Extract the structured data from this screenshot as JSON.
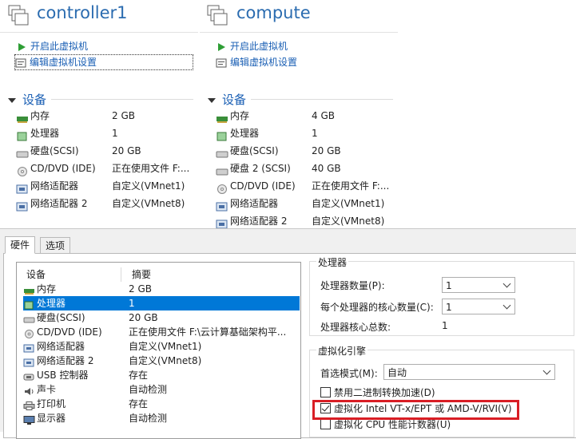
{
  "vms": [
    {
      "name": "controller1",
      "actions": [
        {
          "label": "开启此虚拟机",
          "icon": "play-icon"
        },
        {
          "label": "编辑虚拟机设置",
          "icon": "settings-icon"
        }
      ],
      "section_title": "设备",
      "devices": [
        {
          "name": "内存",
          "value": "2 GB",
          "icon": "memory-icon"
        },
        {
          "name": "处理器",
          "value": "1",
          "icon": "cpu-icon"
        },
        {
          "name": "硬盘(SCSI)",
          "value": "20 GB",
          "icon": "harddisk-icon"
        },
        {
          "name": "CD/DVD (IDE)",
          "value": "正在使用文件 F:...",
          "icon": "cd-dvd-icon"
        },
        {
          "name": "网络适配器",
          "value": "自定义(VMnet1)",
          "icon": "network-icon"
        },
        {
          "name": "网络适配器 2",
          "value": "自定义(VMnet8)",
          "icon": "network-icon"
        }
      ]
    },
    {
      "name": "compute",
      "actions": [
        {
          "label": "开启此虚拟机",
          "icon": "play-icon"
        },
        {
          "label": "编辑虚拟机设置",
          "icon": "settings-icon"
        }
      ],
      "section_title": "设备",
      "devices": [
        {
          "name": "内存",
          "value": "4 GB",
          "icon": "memory-icon"
        },
        {
          "name": "处理器",
          "value": "1",
          "icon": "cpu-icon"
        },
        {
          "name": "硬盘(SCSI)",
          "value": "20 GB",
          "icon": "harddisk-icon"
        },
        {
          "name": "硬盘 2 (SCSI)",
          "value": "40 GB",
          "icon": "harddisk-icon"
        },
        {
          "name": "CD/DVD (IDE)",
          "value": "正在使用文件 F:...",
          "icon": "cd-dvd-icon"
        },
        {
          "name": "网络适配器",
          "value": "自定义(VMnet1)",
          "icon": "network-icon"
        },
        {
          "name": "网络适配器 2",
          "value": "自定义(VMnet8)",
          "icon": "network-icon"
        }
      ]
    }
  ],
  "dialog": {
    "tabs": [
      {
        "label": "硬件",
        "active": true
      },
      {
        "label": "选项",
        "active": false
      }
    ],
    "hardware_list": {
      "columns": [
        "设备",
        "摘要"
      ],
      "rows": [
        {
          "device": "内存",
          "summary": "2 GB",
          "icon": "memory-icon",
          "selected": false
        },
        {
          "device": "处理器",
          "summary": "1",
          "icon": "cpu-icon",
          "selected": true
        },
        {
          "device": "硬盘(SCSI)",
          "summary": "20 GB",
          "icon": "harddisk-icon",
          "selected": false
        },
        {
          "device": "CD/DVD (IDE)",
          "summary": "正在使用文件 F:\\云计算基础架构平...",
          "icon": "cd-dvd-icon",
          "selected": false
        },
        {
          "device": "网络适配器",
          "summary": "自定义(VMnet1)",
          "icon": "network-icon",
          "selected": false
        },
        {
          "device": "网络适配器 2",
          "summary": "自定义(VMnet8)",
          "icon": "network-icon",
          "selected": false
        },
        {
          "device": "USB 控制器",
          "summary": "存在",
          "icon": "usb-icon",
          "selected": false
        },
        {
          "device": "声卡",
          "summary": "自动检测",
          "icon": "sound-icon",
          "selected": false
        },
        {
          "device": "打印机",
          "summary": "存在",
          "icon": "printer-icon",
          "selected": false
        },
        {
          "device": "显示器",
          "summary": "自动检测",
          "icon": "display-icon",
          "selected": false
        }
      ]
    },
    "processor_group": {
      "title": "处理器",
      "count_label": "处理器数量(P):",
      "count_value": "1",
      "cores_label": "每个处理器的核心数量(C):",
      "cores_value": "1",
      "total_label": "处理器核心总数:",
      "total_value": "1"
    },
    "virt_group": {
      "title": "虚拟化引擎",
      "mode_label": "首选模式(M):",
      "mode_value": "自动",
      "options": [
        {
          "label": "禁用二进制转换加速(D)",
          "checked": false
        },
        {
          "label": "虚拟化 Intel VT-x/EPT 或 AMD-V/RVI(V)",
          "checked": true,
          "highlighted": true
        },
        {
          "label": "虚拟化 CPU 性能计数器(U)",
          "checked": false
        }
      ]
    },
    "colors": {
      "selection": "#0078d7",
      "highlight_box": "#d91e25",
      "link": "#1a5fb4"
    }
  }
}
